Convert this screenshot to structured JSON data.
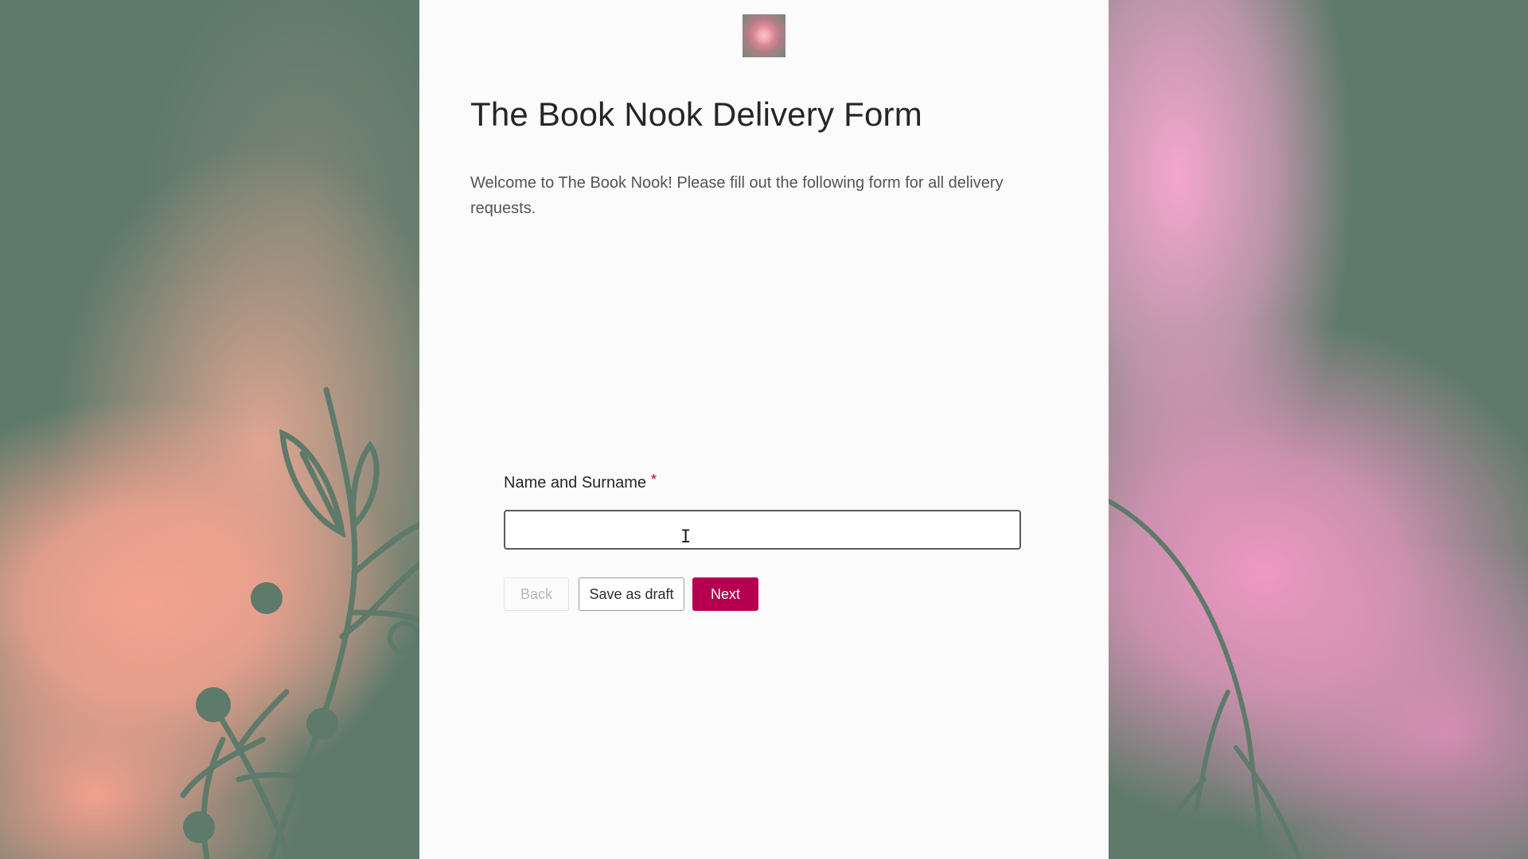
{
  "form": {
    "title": "The Book Nook Delivery Form",
    "description": "Welcome to The Book Nook! Please fill out the following form for all delivery requests.",
    "logo_icon": "flower-logo-icon"
  },
  "field": {
    "label": "Name and Surname",
    "required_mark": "*",
    "value": ""
  },
  "buttons": {
    "back_label": "Back",
    "draft_label": "Save as draft",
    "next_label": "Next"
  },
  "colors": {
    "accent": "#b5004f",
    "panel": "#fbfbfb",
    "sage_background": "#5f7a6b",
    "peach_cloud": "#f4a390",
    "pink_cloud": "#ee98c3"
  },
  "icons": {
    "cursor": "text-cursor-icon"
  }
}
